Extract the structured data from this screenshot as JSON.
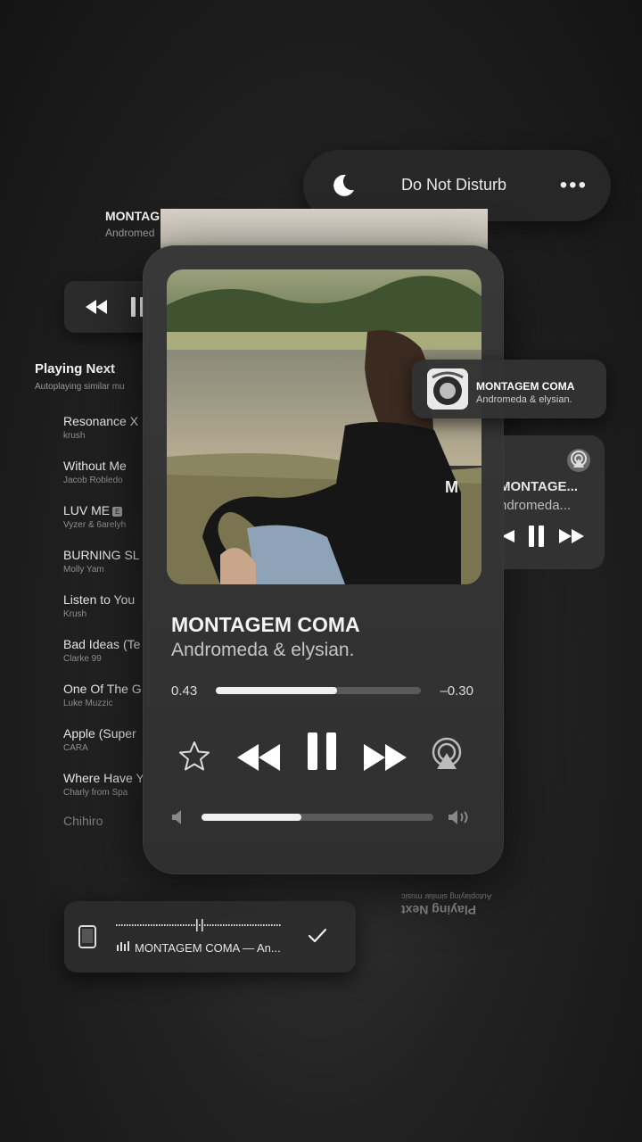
{
  "dnd": {
    "label": "Do Not Disturb",
    "more": "•••"
  },
  "now_playing": {
    "title": "MONTAGEM COMA",
    "artist": "Andromeda & elysian."
  },
  "top_left": {
    "title": "MONTAG",
    "artist": "Andromed"
  },
  "playing_next": {
    "heading": "Playing Next",
    "subtitle": "Autoplaying similar mu",
    "items": [
      {
        "title": "Resonance X",
        "artist": "krush"
      },
      {
        "title": "Without Me",
        "artist": "Jacob Robledo"
      },
      {
        "title": "LUV ME",
        "artist": "Vyzer & 6arelyh",
        "explicit": "E"
      },
      {
        "title": "BURNING SL",
        "artist": "Molly Yam"
      },
      {
        "title": "Listen to You",
        "artist": "Krush"
      },
      {
        "title": "Bad Ideas (Te",
        "artist": "Clarke 99"
      },
      {
        "title": "One Of The G",
        "artist": "Luke Muzzic"
      },
      {
        "title": "Apple (Super",
        "artist": "CARA"
      },
      {
        "title": "Where Have Y",
        "artist": "Charly from Spa"
      }
    ],
    "last": "Chihiro"
  },
  "player": {
    "elapsed": "0.43",
    "remaining": "–0.30",
    "progress": 0.59,
    "volume": 0.43
  },
  "notification": {
    "title": "MONTAGEM COMA",
    "artist": "Andromeda & elysian."
  },
  "side_player": {
    "title": "MONTAGE...",
    "artist": "ndromeda..."
  },
  "device_bar": {
    "track": "MONTAGEM COMA — An..."
  },
  "mirrored": {
    "heading": "Playing Next",
    "subtitle": "Autoplaying similar music"
  },
  "colors": {
    "background": "#1e1e1e",
    "card": "#333333",
    "accent": "#f0f0f0"
  },
  "icons": [
    "moon-icon",
    "rewind-icon",
    "pause-icon",
    "fast-forward-icon",
    "star-icon",
    "airplay-icon",
    "volume-low-icon",
    "volume-high-icon",
    "phone-icon",
    "check-icon",
    "waveform-icon"
  ]
}
